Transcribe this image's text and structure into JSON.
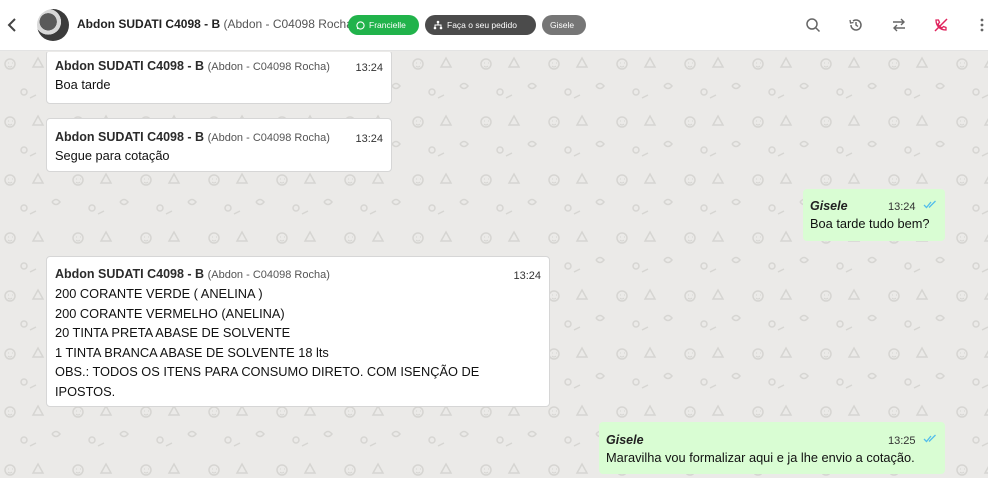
{
  "header": {
    "contact_name": "Abdon SUDATI C4098 - B",
    "contact_sub": "(Abdon - C04098 Rocha)",
    "tags": [
      {
        "label": "Francielle",
        "color": "#21b34b"
      },
      {
        "label": "Faça o seu pedido",
        "color": "#4b4b4b"
      },
      {
        "label": "Gisele",
        "color": "#767676"
      }
    ],
    "icons": [
      "search-icon",
      "history-icon",
      "transfer-icon",
      "end-call-icon",
      "more-icon"
    ]
  },
  "messages": [
    {
      "direction": "in",
      "sender": "Abdon SUDATI C4098 - B",
      "sender_sub": "(Abdon - C04098 Rocha)",
      "time": "13:24",
      "text": "Boa tarde"
    },
    {
      "direction": "in",
      "sender": "Abdon SUDATI C4098 - B",
      "sender_sub": "(Abdon - C04098 Rocha)",
      "time": "13:24",
      "text": "Segue para cotação"
    },
    {
      "direction": "out",
      "sender": "Gisele",
      "time": "13:24",
      "text": "Boa tarde tudo bem?"
    },
    {
      "direction": "in",
      "sender": "Abdon SUDATI C4098 - B",
      "sender_sub": "(Abdon - C04098 Rocha)",
      "time": "13:24",
      "text": "200 CORANTE VERDE ( ANELINA )\n200 CORANTE VERMELHO (ANELINA)\n20 TINTA PRETA ABASE DE SOLVENTE\n1 TINTA BRANCA ABASE DE SOLVENTE 18 lts\nOBS.: TODOS OS ITENS PARA CONSUMO DIRETO. COM ISENÇÃO DE\nIPOSTOS."
    },
    {
      "direction": "out",
      "sender": "Gisele",
      "time": "13:25",
      "text": "Maravilha vou formalizar aqui e ja lhe envio a cotação."
    }
  ],
  "colors": {
    "accent_green": "#21b34b",
    "out_bubble": "#d9fdd3",
    "read_ticks": "#53bdeb",
    "end_call": "#e0245e"
  }
}
